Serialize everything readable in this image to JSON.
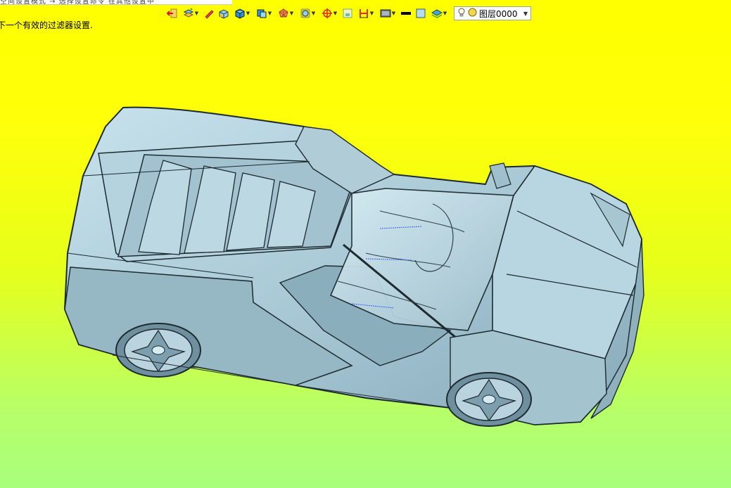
{
  "top_strip": {
    "text": "空间设置模式  → 选择设置命令 在其他设置中"
  },
  "status": {
    "message": "下一个有效的过滤器设置."
  },
  "toolbar": {
    "buttons": [
      {
        "icon": "exit-icon",
        "dropdown": false
      },
      {
        "icon": "layers-stack-icon",
        "dropdown": true
      },
      {
        "icon": "pencil-icon",
        "dropdown": false
      },
      {
        "icon": "solid-box-icon",
        "dropdown": false
      },
      {
        "icon": "shaded-cube-icon",
        "dropdown": true
      },
      {
        "icon": "wire-cube-icon",
        "dropdown": true
      },
      {
        "icon": "view-orientation-icon",
        "dropdown": true
      },
      {
        "icon": "render-mode-icon",
        "dropdown": true
      },
      {
        "icon": "crosshair-icon",
        "dropdown": true
      },
      {
        "icon": "frame-select-icon",
        "dropdown": false
      },
      {
        "icon": "section-plane-icon",
        "dropdown": true
      },
      {
        "icon": "display-panel-icon",
        "dropdown": true
      },
      {
        "icon": "line-color-icon",
        "dropdown": false
      },
      {
        "icon": "face-color-icon",
        "dropdown": false
      },
      {
        "icon": "layer-stack-icon",
        "dropdown": true
      }
    ],
    "layer_selector": {
      "label": "图层0000",
      "icons": [
        "lightbulb-icon",
        "layer-color-icon"
      ]
    }
  },
  "colors": {
    "model_body": "#a9c9d6",
    "model_shadow": "#7f9fae",
    "model_highlight": "#d6ecf3",
    "edge": "#1d2a30",
    "background_top": "#ffff00",
    "background_bottom": "#a8ff7c"
  }
}
